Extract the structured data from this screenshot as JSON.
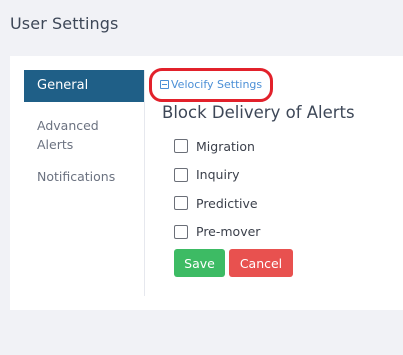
{
  "header": {
    "title": "User Settings"
  },
  "sidebar": {
    "items": [
      {
        "label": "General",
        "active": true
      },
      {
        "label": "Advanced Alerts",
        "active": false
      },
      {
        "label": "Notifications",
        "active": false
      }
    ]
  },
  "main": {
    "link": {
      "label": "Velocify Settings",
      "icon": "external-link-icon"
    },
    "section_title": "Block Delivery of Alerts",
    "options": [
      {
        "label": "Migration",
        "checked": false
      },
      {
        "label": "Inquiry",
        "checked": false
      },
      {
        "label": "Predictive",
        "checked": false
      },
      {
        "label": "Pre-mover",
        "checked": false
      }
    ],
    "save_label": "Save",
    "cancel_label": "Cancel"
  },
  "colors": {
    "active_nav": "#1f5f87",
    "save": "#3dbb64",
    "cancel": "#e8514f",
    "link": "#4b8fd6",
    "highlight_ring": "#e2212b"
  }
}
